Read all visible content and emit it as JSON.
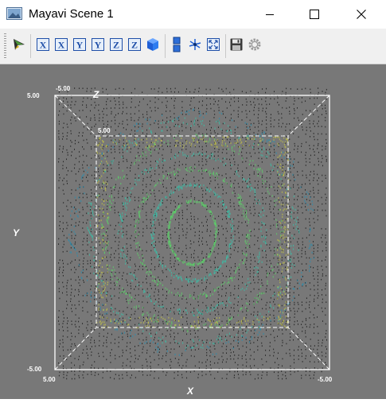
{
  "window": {
    "title": "Mayavi Scene 1"
  },
  "toolbar": {
    "buttons": [
      {
        "name": "mayavi-pipeline-icon"
      },
      {
        "name": "view-x-plus-icon",
        "glyph": "X"
      },
      {
        "name": "view-x-minus-icon",
        "glyph": "X"
      },
      {
        "name": "view-y-plus-icon",
        "glyph": "Y"
      },
      {
        "name": "view-y-minus-icon",
        "glyph": "Y"
      },
      {
        "name": "view-z-plus-icon",
        "glyph": "Z"
      },
      {
        "name": "view-z-minus-icon",
        "glyph": "Z"
      },
      {
        "name": "isometric-view-icon"
      },
      {
        "name": "parallel-projection-icon"
      },
      {
        "name": "toggle-axes-icon"
      },
      {
        "name": "full-screen-icon"
      },
      {
        "name": "save-icon"
      },
      {
        "name": "configure-icon"
      }
    ]
  },
  "scene": {
    "background": "#787878",
    "axes": {
      "x_title": "X",
      "y_title": "Y",
      "z_title": "Z",
      "labels": {
        "top_left_y": "5.00",
        "top_left_z": "-5.00",
        "inner_z": "5.00",
        "bottom_left_y": "-5.00",
        "bottom_left_x": "5.00",
        "bottom_right_x": "-5.00"
      }
    },
    "colors": {
      "outline": "#ffffff",
      "glyph_dark": "#0a0a0a",
      "glyph_teal": "#3bbfa8",
      "glyph_green": "#5ccf6a",
      "glyph_yellow": "#d8d83a",
      "glyph_cyan": "#2a8fb0"
    }
  }
}
